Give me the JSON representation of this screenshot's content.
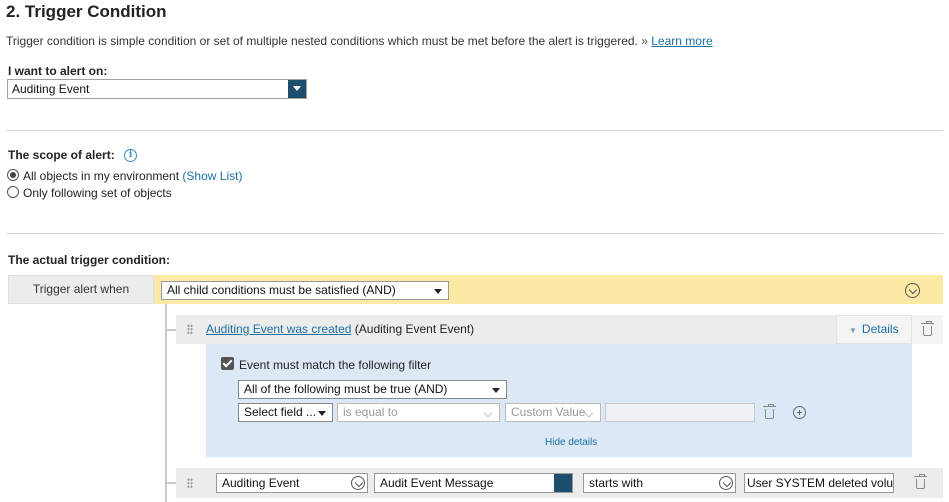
{
  "section": {
    "title": "2. Trigger Condition",
    "description": "Trigger condition is simple condition or set of multiple nested conditions which must be met before the alert is triggered.",
    "raquo": "»",
    "learn_more": "Learn more"
  },
  "alert_on": {
    "label": "I want to alert on:",
    "selected": "Auditing Event"
  },
  "scope": {
    "label": "The scope of alert:",
    "info_icon": "info-icon",
    "option_all": "All objects in my environment",
    "show_list": "(Show List)",
    "option_following": "Only following set of objects",
    "selected": "All objects in my environment"
  },
  "trigger": {
    "heading": "The actual trigger condition:",
    "when_label": "Trigger alert when",
    "and_select": "All child conditions must be satisfied (AND)"
  },
  "condition1": {
    "link": "Auditing Event was created",
    "suffix": "(Auditing Event Event)",
    "details_toggle": "Details",
    "filter_checkbox_label": "Event must match the following filter",
    "filter_checked": true,
    "logic_select": "All of the following must be true (AND)",
    "field_select": "Select field ...",
    "operator_select": "is equal to",
    "value_type_select": "Custom Value",
    "value_input": "",
    "hide_details": "Hide details"
  },
  "condition2": {
    "entity_select": "Auditing Event",
    "field_select": "Audit Event Message",
    "operator_select": "starts with",
    "value_input": "User SYSTEM deleted volu"
  },
  "colors": {
    "accent_link": "#1a6fa3",
    "and_bar": "#fde9a6",
    "details_panel": "#dce8f6",
    "select_arrow": "#1d4e6e"
  }
}
